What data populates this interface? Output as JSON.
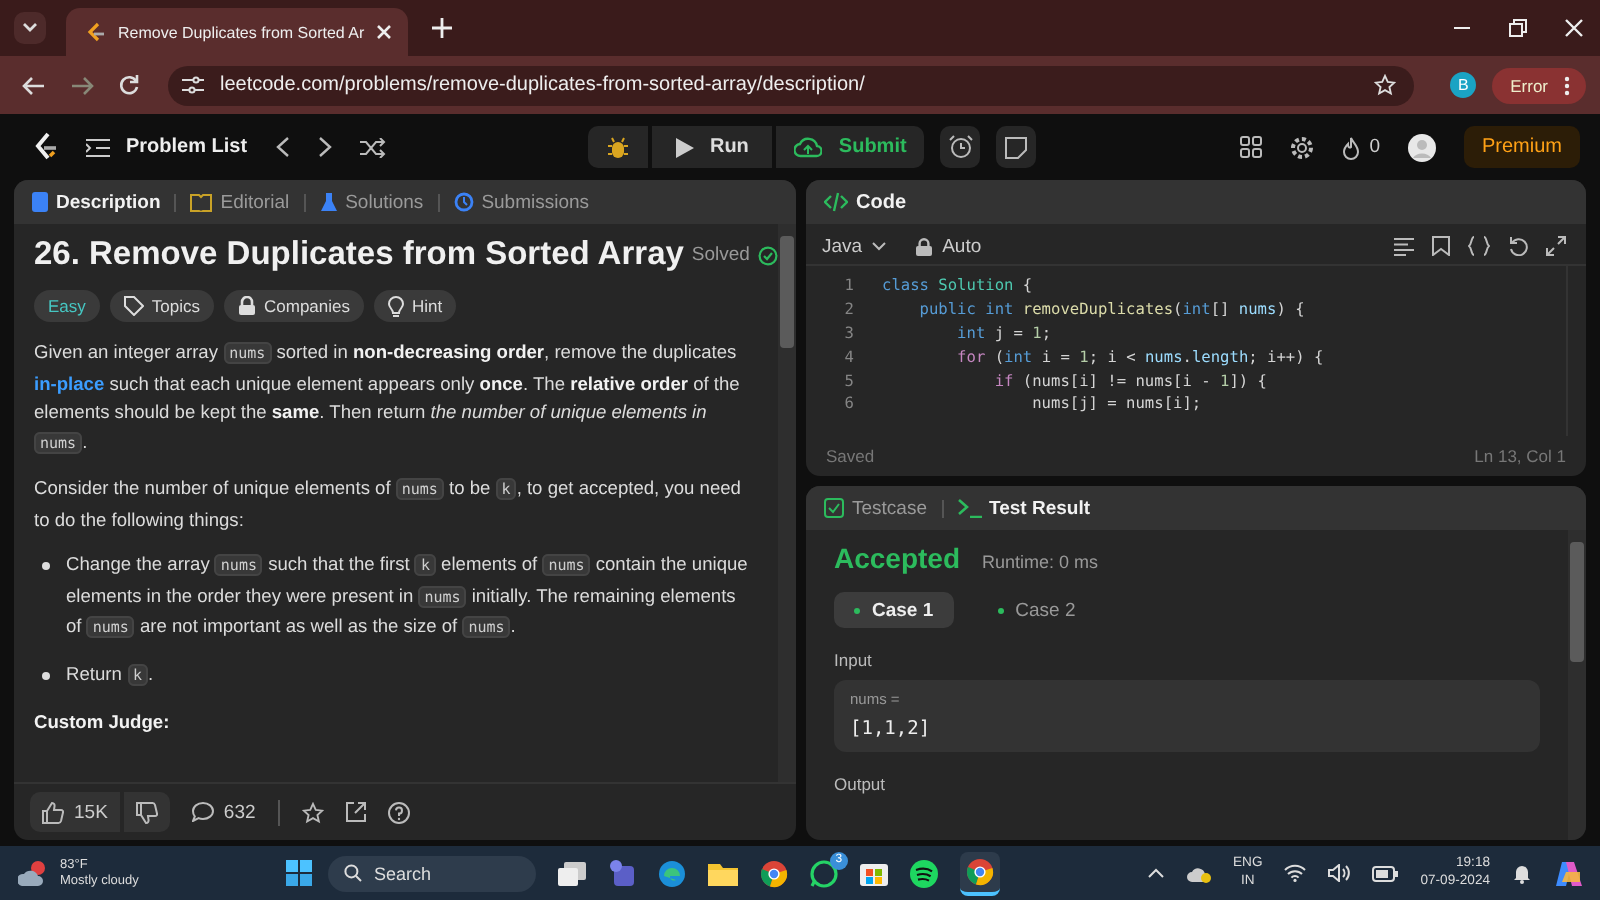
{
  "browser": {
    "tab_title": "Remove Duplicates from Sorted Ar",
    "url": "leetcode.com/problems/remove-duplicates-from-sorted-array/description/",
    "profile": "B",
    "error_button": "Error"
  },
  "nav": {
    "problem_list": "Problem List",
    "run": "Run",
    "submit": "Submit",
    "streak": "0",
    "premium": "Premium"
  },
  "left_tabs": [
    {
      "label": "Description",
      "selected": true
    },
    {
      "label": "Editorial",
      "selected": false
    },
    {
      "label": "Solutions",
      "selected": false
    },
    {
      "label": "Submissions",
      "selected": false
    }
  ],
  "problem": {
    "title": "26. Remove Duplicates from Sorted Array",
    "status": "Solved",
    "difficulty": "Easy",
    "tags": [
      "Topics",
      "Companies",
      "Hint"
    ],
    "paragraphs": [
      [
        {
          "t": "Given an integer array ",
          "kind": "text"
        },
        {
          "t": "nums",
          "kind": "code"
        },
        {
          "t": " sorted in ",
          "kind": "text"
        },
        {
          "t": "non-decreasing order",
          "kind": "bold"
        },
        {
          "t": ", remove the duplicates ",
          "kind": "text"
        },
        {
          "t": "in-place",
          "kind": "link"
        },
        {
          "t": " such that each unique element appears only ",
          "kind": "text"
        },
        {
          "t": "once",
          "kind": "bold"
        },
        {
          "t": ". The ",
          "kind": "text"
        },
        {
          "t": "relative order",
          "kind": "bold"
        },
        {
          "t": " of the elements should be kept the ",
          "kind": "text"
        },
        {
          "t": "same",
          "kind": "bold"
        },
        {
          "t": ". Then return ",
          "kind": "text"
        },
        {
          "t": "the number of unique elements in ",
          "kind": "italic"
        },
        {
          "t": "nums",
          "kind": "code"
        },
        {
          "t": ".",
          "kind": "text"
        }
      ],
      [
        {
          "t": "Consider the number of unique elements of ",
          "kind": "text"
        },
        {
          "t": "nums",
          "kind": "code"
        },
        {
          "t": " to be ",
          "kind": "text"
        },
        {
          "t": "k",
          "kind": "code"
        },
        {
          "t": ", to get accepted, you need to do the following things:",
          "kind": "text"
        }
      ]
    ],
    "bullets": [
      [
        {
          "t": "Change the array ",
          "kind": "text"
        },
        {
          "t": "nums",
          "kind": "code"
        },
        {
          "t": " such that the first ",
          "kind": "text"
        },
        {
          "t": "k",
          "kind": "code"
        },
        {
          "t": " elements of ",
          "kind": "text"
        },
        {
          "t": "nums",
          "kind": "code"
        },
        {
          "t": " contain the unique elements in the order they were present in ",
          "kind": "text"
        },
        {
          "t": "nums",
          "kind": "code"
        },
        {
          "t": " initially. The remaining elements of ",
          "kind": "text"
        },
        {
          "t": "nums",
          "kind": "code"
        },
        {
          "t": " are not important as well as the size of ",
          "kind": "text"
        },
        {
          "t": "nums",
          "kind": "code"
        },
        {
          "t": ".",
          "kind": "text"
        }
      ],
      [
        {
          "t": "Return ",
          "kind": "text"
        },
        {
          "t": "k",
          "kind": "code"
        },
        {
          "t": ".",
          "kind": "text"
        }
      ]
    ],
    "heading": "Custom Judge:",
    "likes": "15K",
    "comments": "632"
  },
  "editor": {
    "title": "Code",
    "language": "Java",
    "mode": "Auto",
    "status": "Saved",
    "cursor": "Ln 13, Col 1",
    "lines": [
      {
        "n": "1",
        "tokens": [
          {
            "t": "class ",
            "kind": "kw"
          },
          {
            "t": "Solution",
            "kind": "type"
          },
          {
            "t": " {",
            "kind": "p"
          }
        ]
      },
      {
        "n": "2",
        "tokens": [
          {
            "t": "    public int ",
            "kind": "kw"
          },
          {
            "t": "removeDuplicates",
            "kind": "fn"
          },
          {
            "t": "(",
            "kind": "p"
          },
          {
            "t": "int",
            "kind": "kw"
          },
          {
            "t": "[] ",
            "kind": "p"
          },
          {
            "t": "nums",
            "kind": "var"
          },
          {
            "t": ") {",
            "kind": "p"
          }
        ]
      },
      {
        "n": "3",
        "tokens": [
          {
            "t": "        int",
            "kind": "kw"
          },
          {
            "t": " j = ",
            "kind": "p"
          },
          {
            "t": "1",
            "kind": "num"
          },
          {
            "t": ";",
            "kind": "p"
          }
        ]
      },
      {
        "n": "4",
        "tokens": [
          {
            "t": "        for",
            "kind": "ctl"
          },
          {
            "t": " (",
            "kind": "p"
          },
          {
            "t": "int",
            "kind": "kw"
          },
          {
            "t": " i = ",
            "kind": "p"
          },
          {
            "t": "1",
            "kind": "num"
          },
          {
            "t": "; i < ",
            "kind": "p"
          },
          {
            "t": "nums",
            "kind": "var"
          },
          {
            "t": ".",
            "kind": "p"
          },
          {
            "t": "length",
            "kind": "var"
          },
          {
            "t": "; i++) {",
            "kind": "p"
          }
        ]
      },
      {
        "n": "5",
        "tokens": [
          {
            "t": "            if",
            "kind": "ctl"
          },
          {
            "t": " (nums[i] != nums[i - ",
            "kind": "p"
          },
          {
            "t": "1",
            "kind": "num"
          },
          {
            "t": "]) {",
            "kind": "p"
          }
        ]
      },
      {
        "n": "6",
        "tokens": [
          {
            "t": "                nums[j] = nums[i];",
            "kind": "p"
          }
        ]
      }
    ]
  },
  "test_tabs": [
    {
      "label": "Testcase",
      "selected": false
    },
    {
      "label": "Test Result",
      "selected": true
    }
  ],
  "result": {
    "verdict": "Accepted",
    "runtime": "Runtime: 0 ms",
    "cases": [
      {
        "label": "Case 1",
        "selected": true
      },
      {
        "label": "Case 2",
        "selected": false
      }
    ],
    "input_label": "Input",
    "variable": "nums =",
    "value": "[1,1,2]",
    "output_label": "Output"
  },
  "taskbar": {
    "temperature": "83°F",
    "weather": "Mostly cloudy",
    "search": "Search",
    "whatsapp_badge": "3",
    "language": "ENG",
    "region": "IN",
    "time": "19:18",
    "date": "07-09-2024"
  }
}
